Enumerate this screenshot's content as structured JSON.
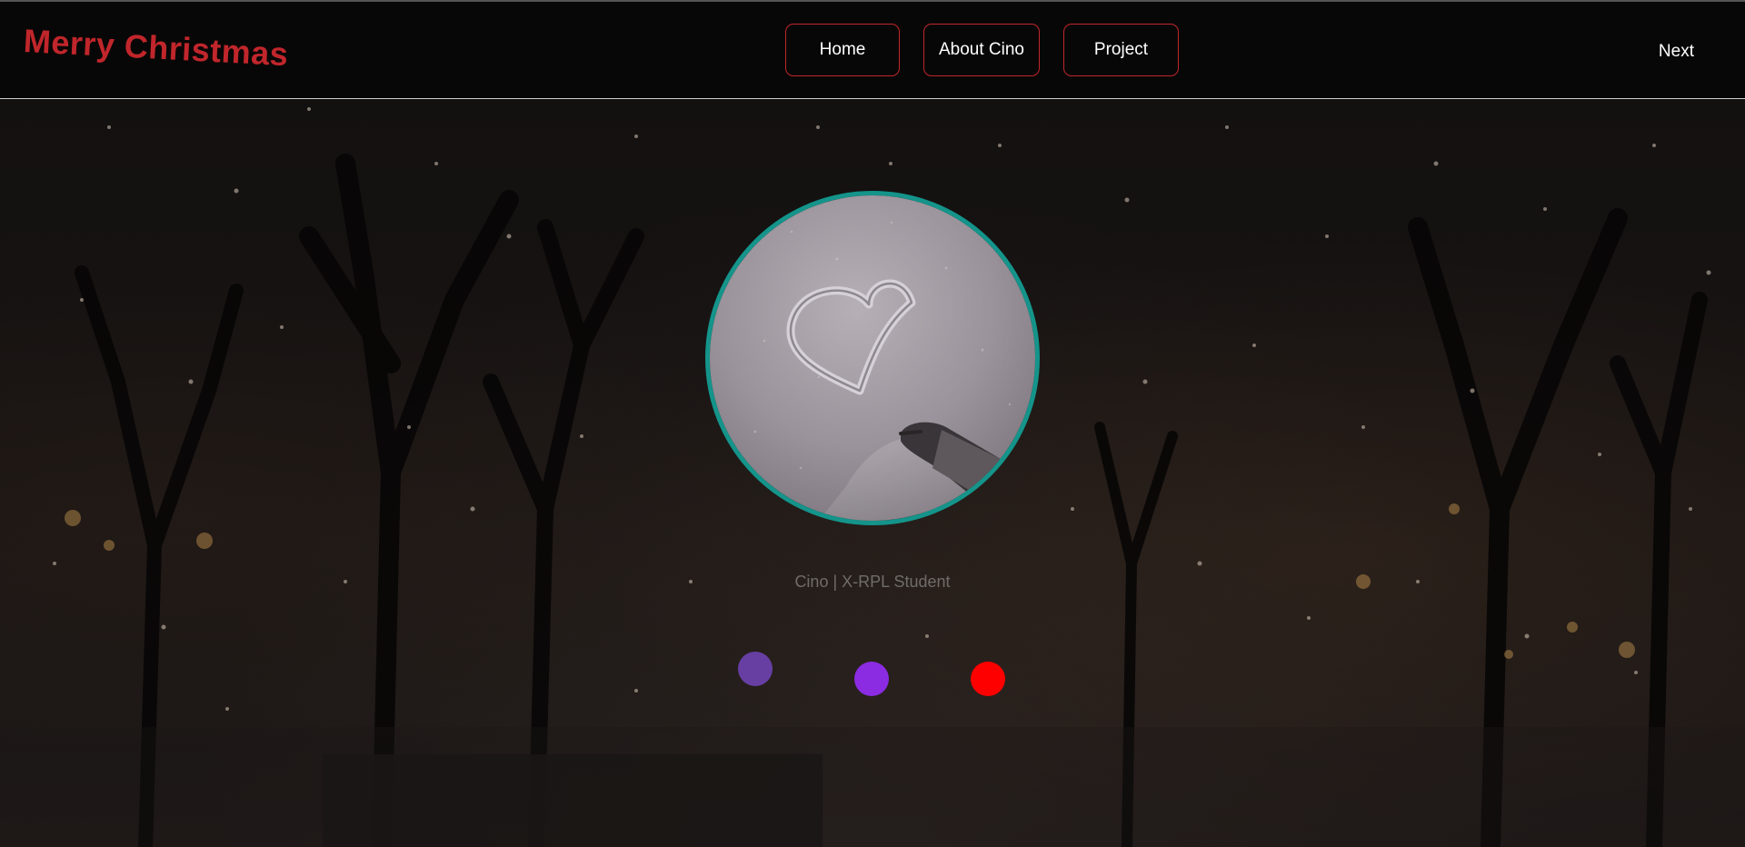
{
  "header": {
    "logo": "Merry Christmas",
    "nav": [
      {
        "label": "Home"
      },
      {
        "label": "About Cino"
      },
      {
        "label": "Project"
      }
    ],
    "next_label": "Next"
  },
  "hero": {
    "avatar_image": "heart drawn in snow with a hand",
    "subtitle": "Cino | X-RPL Student"
  },
  "dots": [
    {
      "color": "#673fa3"
    },
    {
      "color": "#8b2be2"
    },
    {
      "color": "#ff0000"
    }
  ],
  "colors": {
    "accent_red": "#c0262b",
    "avatar_border": "#14948a",
    "background": "#121010"
  }
}
